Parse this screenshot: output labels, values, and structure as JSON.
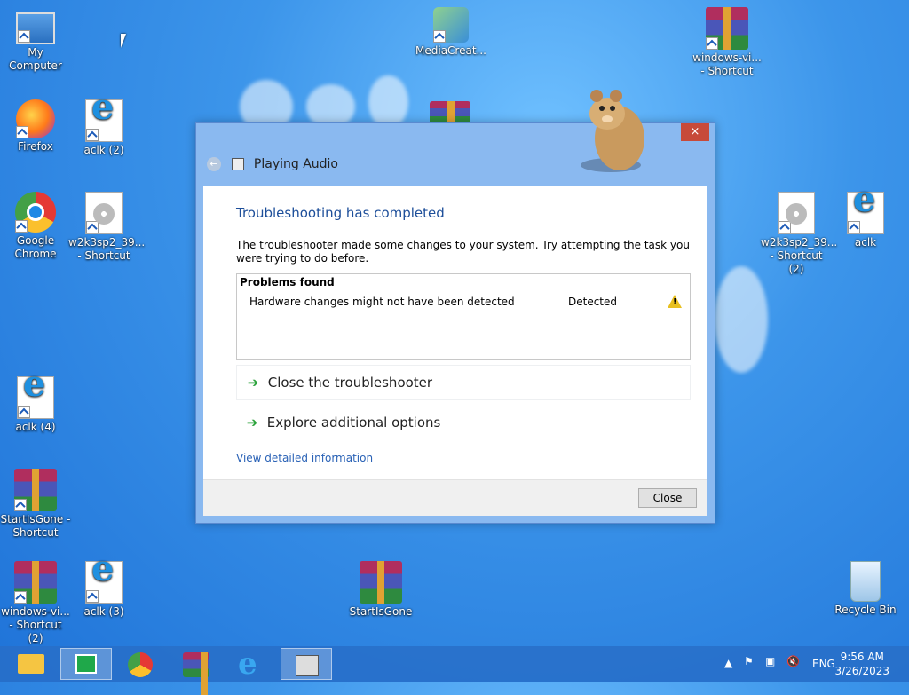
{
  "desktop": {
    "icons": [
      {
        "label": "My Computer"
      },
      {
        "label": "MediaCreat..."
      },
      {
        "label": "windows-vi... - Shortcut"
      },
      {
        "label": "Firefox"
      },
      {
        "label": "aclk (2)"
      },
      {
        "label": "Google Chrome"
      },
      {
        "label": "w2k3sp2_39... - Shortcut"
      },
      {
        "label": "w2k3sp2_39... - Shortcut (2)"
      },
      {
        "label": "aclk"
      },
      {
        "label": "aclk (4)"
      },
      {
        "label": "StartIsGone - Shortcut"
      },
      {
        "label": "windows-vi... - Shortcut (2)"
      },
      {
        "label": "aclk (3)"
      },
      {
        "label": "StartIsGone"
      },
      {
        "label": "Recycle Bin"
      }
    ]
  },
  "dialog": {
    "title": "Playing Audio",
    "close_glyph": "×",
    "heading": "Troubleshooting has completed",
    "description": "The troubleshooter made some changes to your system. Try attempting the task you were trying to do before.",
    "problems": {
      "header": "Problems found",
      "rows": [
        {
          "problem": "Hardware changes might not have been detected",
          "status": "Detected"
        }
      ]
    },
    "options": [
      {
        "label": "Close the troubleshooter"
      },
      {
        "label": "Explore additional options"
      }
    ],
    "link": "View detailed information",
    "close_button": "Close"
  },
  "taskbar": {
    "language": "ENG",
    "time": "9:56 AM",
    "date": "3/26/2023"
  }
}
